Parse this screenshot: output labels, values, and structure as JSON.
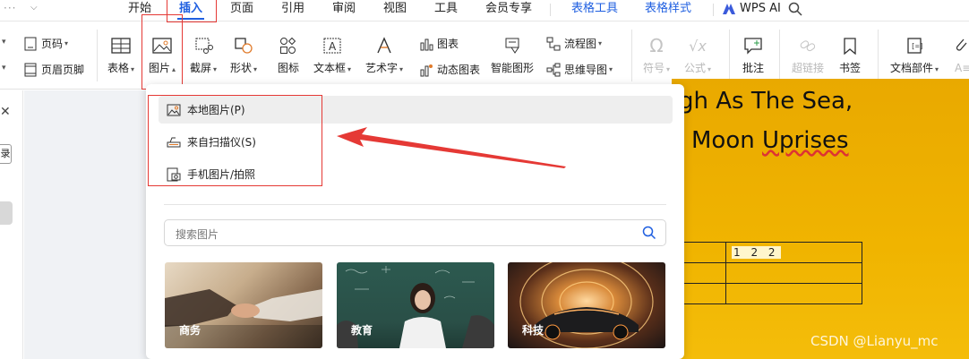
{
  "menu": {
    "tabs": [
      "开始",
      "插入",
      "页面",
      "引用",
      "审阅",
      "视图",
      "工具",
      "会员专享",
      "表格工具",
      "表格样式",
      "WPS AI"
    ],
    "active_tab": "插入"
  },
  "ribbon": {
    "page_number": "页码",
    "header_footer": "页眉页脚",
    "table": "表格",
    "picture": "图片",
    "screenshot": "截屏",
    "shape": "形状",
    "icon": "图标",
    "textbox": "文本框",
    "wordart": "艺术字",
    "chart": "图表",
    "dynamic_chart": "动态图表",
    "smart_graphic": "智能图形",
    "flowchart": "流程图",
    "mindmap": "思维导图",
    "symbol": "符号",
    "formula": "公式",
    "comment": "批注",
    "hyperlink": "超链接",
    "bookmark": "书签",
    "doc_parts": "文档部件"
  },
  "left_panel": {
    "tag": "录"
  },
  "dropdown": {
    "options": [
      "本地图片(P)",
      "来自扫描仪(S)",
      "手机图片/拍照"
    ],
    "search_placeholder": "搜索图片",
    "categories": [
      "商务",
      "教育",
      "科技"
    ]
  },
  "document": {
    "line1": "gh As The Sea,",
    "line2_plain": "Moon ",
    "line2_squiggle": "Uprises",
    "table_cell": "1 2 2"
  },
  "watermark": "CSDN @Lianyu_mc",
  "colors": {
    "accent": "#1f5fe0",
    "annotation_red": "#e53935",
    "page_gold": "#f0b400"
  }
}
